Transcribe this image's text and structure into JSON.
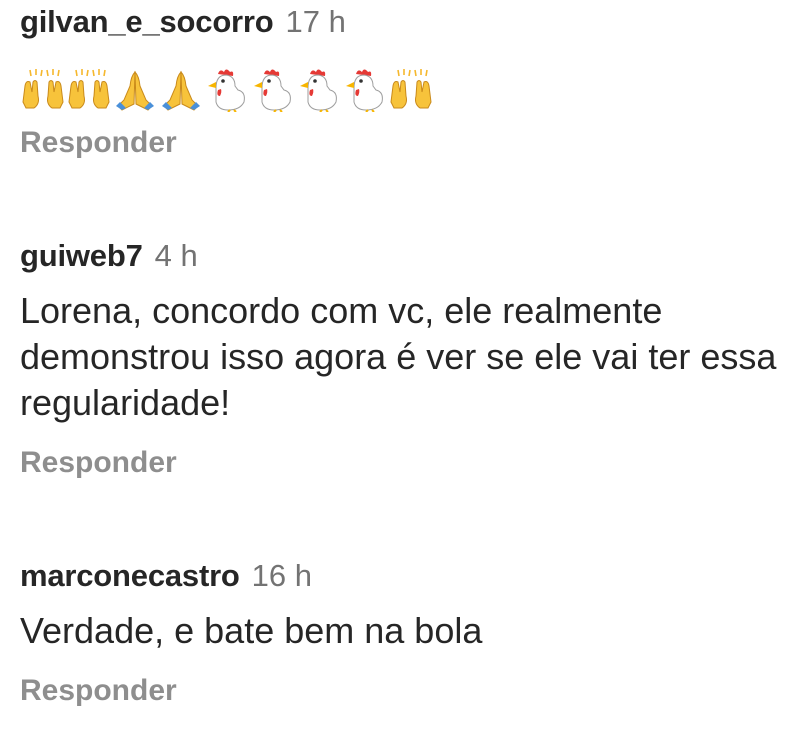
{
  "comments": [
    {
      "username": "gilvan_e_socorro",
      "time": "17 h",
      "emojis": [
        "raising-hands-icon",
        "raising-hands-icon",
        "folded-hands-icon",
        "folded-hands-icon",
        "rooster-icon",
        "rooster-icon",
        "rooster-icon",
        "rooster-icon",
        "raising-hands-icon"
      ],
      "reply_label": "Responder"
    },
    {
      "username": "guiweb7",
      "time": "4 h",
      "text": "Lorena, concordo com vc, ele realmente demonstrou isso agora é ver se ele vai ter essa regularidade!",
      "reply_label": "Responder"
    },
    {
      "username": "marconecastro",
      "time": "16 h",
      "text": "Verdade, e bate bem na bola",
      "reply_label": "Responder"
    }
  ]
}
